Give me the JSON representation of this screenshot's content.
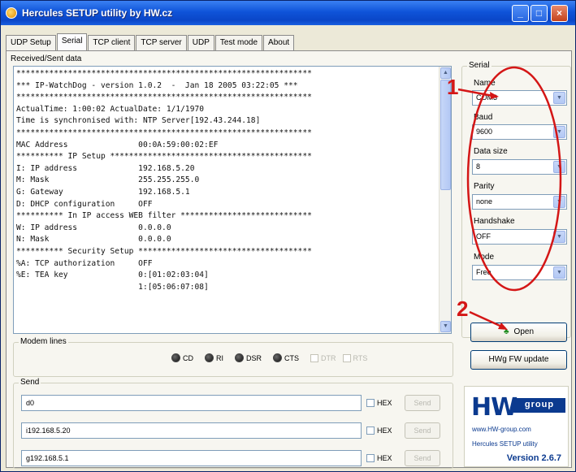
{
  "window": {
    "title": "Hercules SETUP utility by HW.cz",
    "controls": [
      "_",
      "□",
      "×"
    ]
  },
  "tabs": [
    {
      "label": "UDP Setup"
    },
    {
      "label": "Serial",
      "active": true
    },
    {
      "label": "TCP client"
    },
    {
      "label": "TCP server"
    },
    {
      "label": "UDP"
    },
    {
      "label": "Test mode"
    },
    {
      "label": "About"
    }
  ],
  "received": {
    "label": "Received/Sent data",
    "lines": [
      "***************************************************************",
      "*** IP-WatchDog - version 1.0.2  -  Jan 18 2005 03:22:05 ***",
      "***************************************************************",
      "ActualTime: 1:00:02 ActualDate: 1/1/1970",
      "Time is synchronised with: NTP Server[192.43.244.18]",
      "***************************************************************",
      "MAC Address               00:0A:59:00:02:EF",
      "********** IP Setup *******************************************",
      "I: IP address             192.168.5.20",
      "M: Mask                   255.255.255.0",
      "G: Gateway                192.168.5.1",
      "D: DHCP configuration     OFF",
      "********** In IP access WEB filter ****************************",
      "W: IP address             0.0.0.0",
      "N: Mask                   0.0.0.0",
      "********** Security Setup *************************************",
      "%A: TCP authorization     OFF",
      "%E: TEA key               0:[01:02:03:04]",
      "                          1:[05:06:07:08]"
    ]
  },
  "serial": {
    "group_label": "Serial",
    "name_label": "Name",
    "name_value": "COM3",
    "baud_label": "Baud",
    "baud_value": "9600",
    "datasize_label": "Data size",
    "datasize_value": "8",
    "parity_label": "Parity",
    "parity_value": "none",
    "handshake_label": "Handshake",
    "handshake_value": "OFF",
    "mode_label": "Mode",
    "mode_value": "Free",
    "open_label": "Open",
    "fw_update_label": "HWg FW update"
  },
  "modem": {
    "group_label": "Modem lines",
    "leds": [
      "CD",
      "RI",
      "DSR",
      "CTS"
    ],
    "checkboxes": [
      "DTR",
      "RTS"
    ]
  },
  "send": {
    "group_label": "Send",
    "rows": [
      {
        "value": "d0",
        "hex_label": "HEX",
        "button_label": "Send"
      },
      {
        "value": "i192.168.5.20",
        "hex_label": "HEX",
        "button_label": "Send"
      },
      {
        "value": "g192.168.5.1",
        "hex_label": "HEX",
        "button_label": "Send"
      }
    ]
  },
  "logo": {
    "hw": "HW",
    "group": "group",
    "url": "www.HW-group.com",
    "product": "Hercules SETUP utility",
    "version": "Version 2.6.7"
  },
  "annotations": {
    "callout_1": "1",
    "callout_2": "2",
    "color": "#d41616"
  }
}
